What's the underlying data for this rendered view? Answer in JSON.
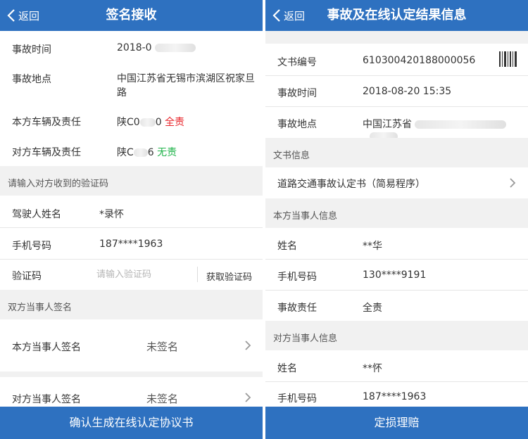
{
  "left": {
    "nav": {
      "back_label": "返回",
      "title": "签名接收"
    },
    "accident": {
      "time_label": "事故时间",
      "time_value": "2018-0",
      "place_label": "事故地点",
      "place_value": "中国江苏省无锡市滨湖区祝家旦路",
      "own_vehicle_label": "本方车辆及责任",
      "own_plate": "陕C0",
      "own_plate_tail": "0",
      "own_liability": "全责",
      "other_vehicle_label": "对方车辆及责任",
      "other_plate": "陕C",
      "other_plate_tail": "6",
      "other_liability": "无责"
    },
    "verify_section": "请输入对方收到的验证码",
    "verify": {
      "driver_label": "驾驶人姓名",
      "driver_value": "*录怀",
      "phone_label": "手机号码",
      "phone_value": "187****1963",
      "code_label": "验证码",
      "code_placeholder": "请输入验证码",
      "get_code_label": "获取验证码"
    },
    "sign_section": "双方当事人签名",
    "sign": {
      "own_label": "本方当事人签名",
      "own_status": "未签名",
      "other_label": "对方当事人签名",
      "other_status": "未签名"
    },
    "confirm_button": "确认生成在线认定协议书"
  },
  "right": {
    "nav": {
      "back_label": "返回",
      "title": "事故及在线认定结果信息"
    },
    "doc": {
      "number_label": "文书编号",
      "number_value": "610300420188000056",
      "time_label": "事故时间",
      "time_value": "2018-08-20 15:35",
      "place_label": "事故地点",
      "place_value": "中国江苏省"
    },
    "doc_section": "文书信息",
    "doc_item": "道路交通事故认定书（简易程序）",
    "own_section": "本方当事人信息",
    "own": {
      "name_label": "姓名",
      "name_value": "**华",
      "phone_label": "手机号码",
      "phone_value": "130****9191",
      "liability_label": "事故责任",
      "liability_value": "全责"
    },
    "other_section": "对方当事人信息",
    "other": {
      "name_label": "姓名",
      "name_value": "**怀",
      "phone_label": "手机号码",
      "phone_value": "187****1963"
    },
    "claim_button": "定损理赔"
  },
  "colors": {
    "primary": "#2e71c0",
    "danger": "#e8242a",
    "success": "#1fb34a"
  },
  "icons": [
    "back-chevron-icon",
    "chevron-right-icon",
    "barcode-icon"
  ]
}
